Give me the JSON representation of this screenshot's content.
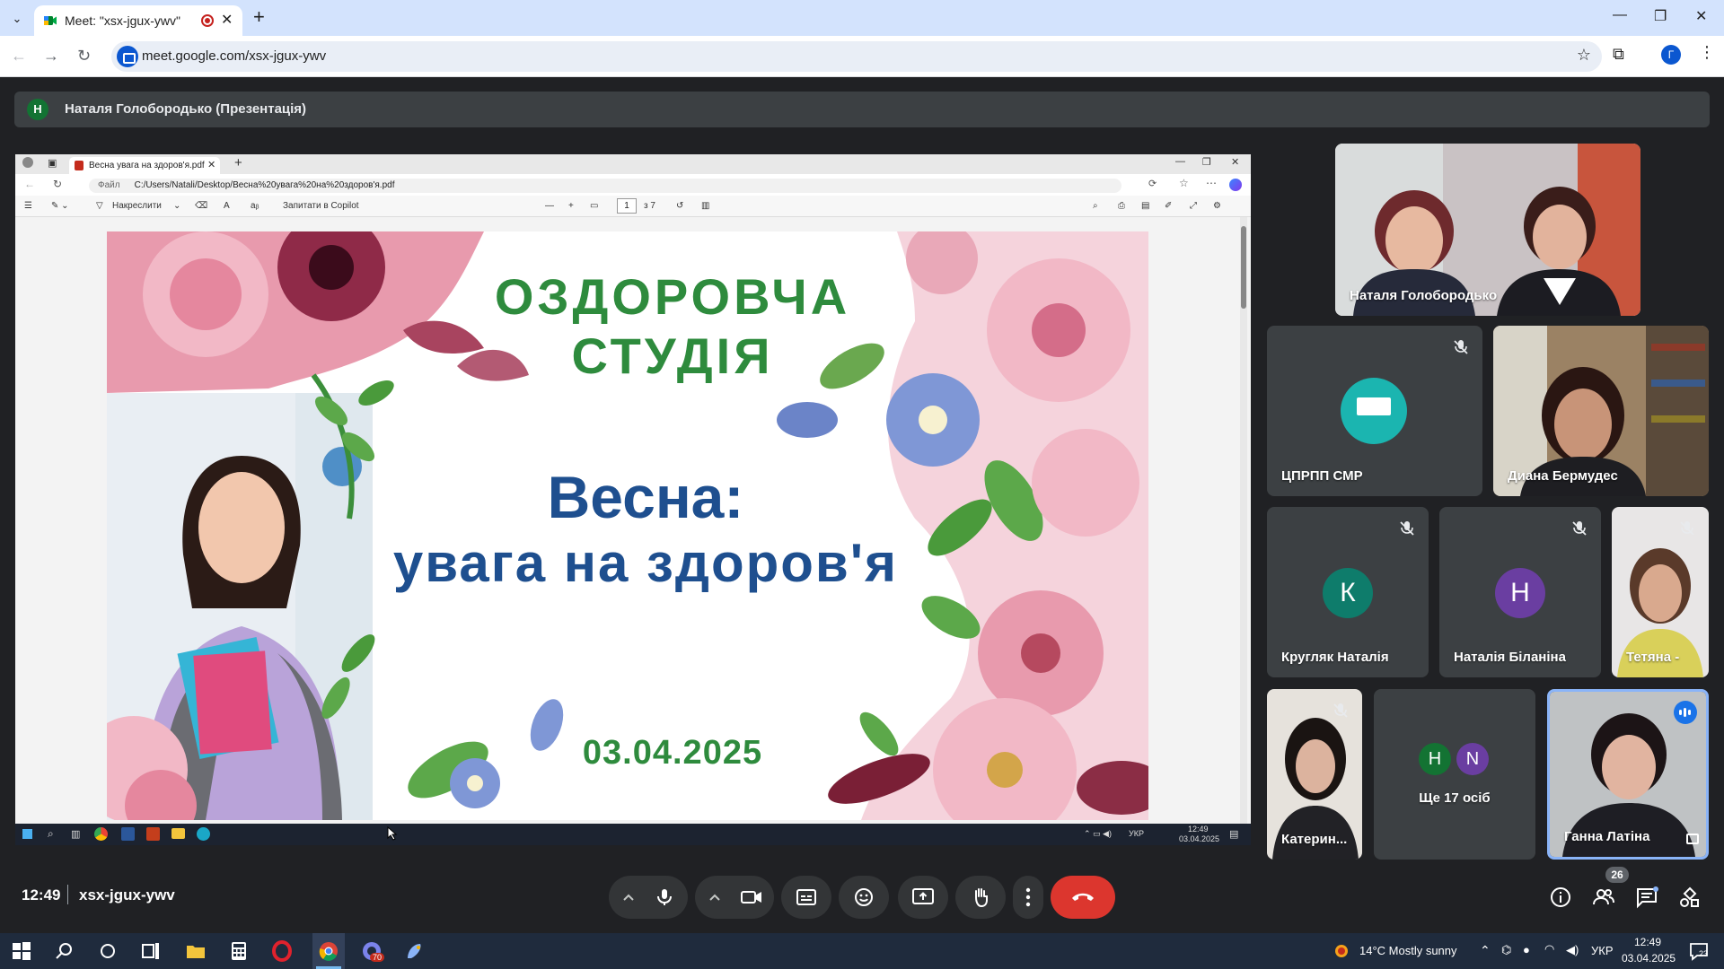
{
  "browser": {
    "tab_title": "Meet: \"xsx-jgux-ywv\"",
    "url": "meet.google.com/xsx-jgux-ywv",
    "profile_initial": "Г"
  },
  "presenter": {
    "initial": "Н",
    "label": "Наталя Голобородько (Презентація)"
  },
  "shared": {
    "tab_title": "Весна увага на здоров'я.pdf",
    "url_label": "Файл",
    "url": "C:/Users/Natali/Desktop/Весна%20увага%20на%20здоров'я.pdf",
    "draw_label": "Накреслити",
    "copilot_label": "Запитати в Copilot",
    "page_current": "1",
    "page_total": "з 7",
    "slide": {
      "title_line1": "ОЗДОРОВЧА",
      "title_line2": "СТУДІЯ",
      "subtitle_line1": "Весна:",
      "subtitle_line2": "увага на здоров'я",
      "date": "03.04.2025"
    },
    "taskbar_lang": "УКР",
    "taskbar_time": "12:49",
    "taskbar_date": "03.04.2025"
  },
  "participants": {
    "t1": {
      "name": "Наталя Голобородько"
    },
    "t2": {
      "name": "ЦПРПП СМР"
    },
    "t3": {
      "name": "Диана Бермудес"
    },
    "t4": {
      "name": "Кругляк Наталія",
      "initial": "К"
    },
    "t5": {
      "name": "Наталія Біланіна",
      "initial": "Н"
    },
    "t6": {
      "name": "Тетяна -"
    },
    "t7": {
      "name": "Катерин..."
    },
    "t8": {
      "name": "Ще 17 осіб",
      "initial_a": "Н",
      "initial_b": "N"
    },
    "t9": {
      "name": "Ганна Латіна"
    }
  },
  "meeting": {
    "time": "12:49",
    "code": "xsx-jgux-ywv",
    "participant_count": "26"
  },
  "taskbar": {
    "teams_badge": "70",
    "weather": "14°C  Mostly sunny",
    "lang": "УКР",
    "time": "12:49",
    "date": "03.04.2025",
    "notif_count": "23"
  },
  "colors": {
    "hangup": "#dc362e",
    "avatar_teal": "#0e7c6b",
    "avatar_purple": "#6a3ea1",
    "avatar_green": "#137333",
    "speaking_border": "#8ab4f8"
  }
}
